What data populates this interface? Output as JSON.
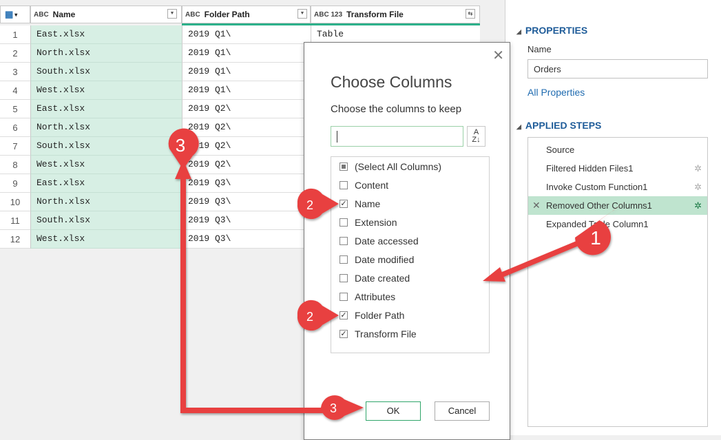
{
  "grid": {
    "columns": [
      {
        "type_icon": "ABC",
        "name": "Name"
      },
      {
        "type_icon": "ABC",
        "name": "Folder Path"
      },
      {
        "type_icon": "ABC 123",
        "name": "Transform File"
      }
    ],
    "rows": [
      {
        "n": "1",
        "name": "East.xlsx",
        "path": "2019 Q1\\",
        "transform": "Table"
      },
      {
        "n": "2",
        "name": "North.xlsx",
        "path": "2019 Q1\\",
        "transform": ""
      },
      {
        "n": "3",
        "name": "South.xlsx",
        "path": "2019 Q1\\",
        "transform": ""
      },
      {
        "n": "4",
        "name": "West.xlsx",
        "path": "2019 Q1\\",
        "transform": ""
      },
      {
        "n": "5",
        "name": "East.xlsx",
        "path": "2019 Q2\\",
        "transform": ""
      },
      {
        "n": "6",
        "name": "North.xlsx",
        "path": "2019 Q2\\",
        "transform": ""
      },
      {
        "n": "7",
        "name": "South.xlsx",
        "path": "2019 Q2\\",
        "transform": ""
      },
      {
        "n": "8",
        "name": "West.xlsx",
        "path": "2019 Q2\\",
        "transform": ""
      },
      {
        "n": "9",
        "name": "East.xlsx",
        "path": "2019 Q3\\",
        "transform": ""
      },
      {
        "n": "10",
        "name": "North.xlsx",
        "path": "2019 Q3\\",
        "transform": ""
      },
      {
        "n": "11",
        "name": "South.xlsx",
        "path": "2019 Q3\\",
        "transform": ""
      },
      {
        "n": "12",
        "name": "West.xlsx",
        "path": "2019 Q3\\",
        "transform": ""
      }
    ]
  },
  "properties": {
    "heading": "PROPERTIES",
    "name_label": "Name",
    "name_value": "Orders",
    "all_properties": "All Properties"
  },
  "applied_steps": {
    "heading": "APPLIED STEPS",
    "steps": [
      {
        "label": "Source",
        "selected": false
      },
      {
        "label": "Filtered Hidden Files1",
        "selected": false
      },
      {
        "label": "Invoke Custom Function1",
        "selected": false
      },
      {
        "label": "Removed Other Columns1",
        "selected": true
      },
      {
        "label": "Expanded Table Column1",
        "selected": false
      }
    ]
  },
  "dialog": {
    "title": "Choose Columns",
    "subtitle": "Choose the columns to keep",
    "search_value": "",
    "sort_icon": "sort-az-icon",
    "options": [
      {
        "label": "(Select All Columns)",
        "state": "indeterminate"
      },
      {
        "label": "Content",
        "state": "unchecked"
      },
      {
        "label": "Name",
        "state": "checked"
      },
      {
        "label": "Extension",
        "state": "unchecked"
      },
      {
        "label": "Date accessed",
        "state": "unchecked"
      },
      {
        "label": "Date modified",
        "state": "unchecked"
      },
      {
        "label": "Date created",
        "state": "unchecked"
      },
      {
        "label": "Attributes",
        "state": "unchecked"
      },
      {
        "label": "Folder Path",
        "state": "checked"
      },
      {
        "label": "Transform File",
        "state": "checked"
      }
    ],
    "ok_label": "OK",
    "cancel_label": "Cancel"
  },
  "annotations": {
    "callout_1": "1",
    "callout_2a": "2",
    "callout_2b": "2",
    "callout_3a": "3",
    "callout_3b": "3",
    "callout_color": "#e8403f"
  }
}
